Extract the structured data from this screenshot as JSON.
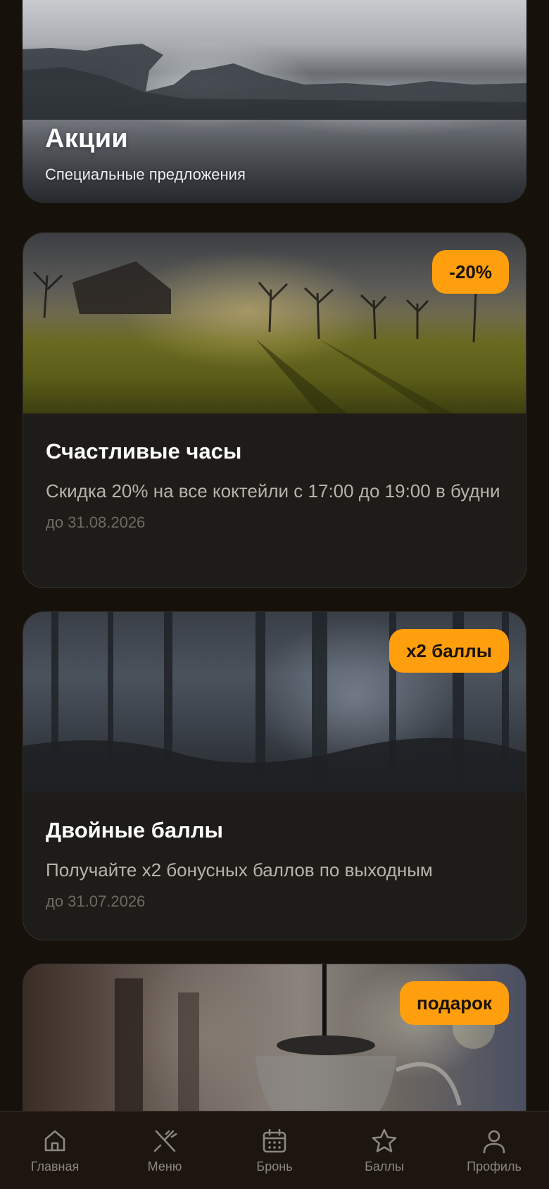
{
  "hero": {
    "title": "Акции",
    "subtitle": "Специальные предложения"
  },
  "promos": [
    {
      "badge": "-20%",
      "title": "Счастливые часы",
      "description": "Скидка 20% на все коктейли с 17:00 до 19:00 в будни",
      "date": "до 31.08.2026"
    },
    {
      "badge": "x2 баллы",
      "title": "Двойные баллы",
      "description": "Получайте x2 бонусных баллов по выходным",
      "date": "до 31.07.2026"
    },
    {
      "badge": "подарок"
    }
  ],
  "tabbar": {
    "items": [
      {
        "label": "Главная",
        "icon": "home-icon"
      },
      {
        "label": "Меню",
        "icon": "cutlery-icon"
      },
      {
        "label": "Бронь",
        "icon": "calendar-icon"
      },
      {
        "label": "Баллы",
        "icon": "star-icon"
      },
      {
        "label": "Профиль",
        "icon": "user-icon"
      }
    ]
  },
  "colors": {
    "background": "#17110c",
    "accent": "#ff9f0e",
    "card": "#1e1c18",
    "muted_text": "#b7b3ab"
  }
}
